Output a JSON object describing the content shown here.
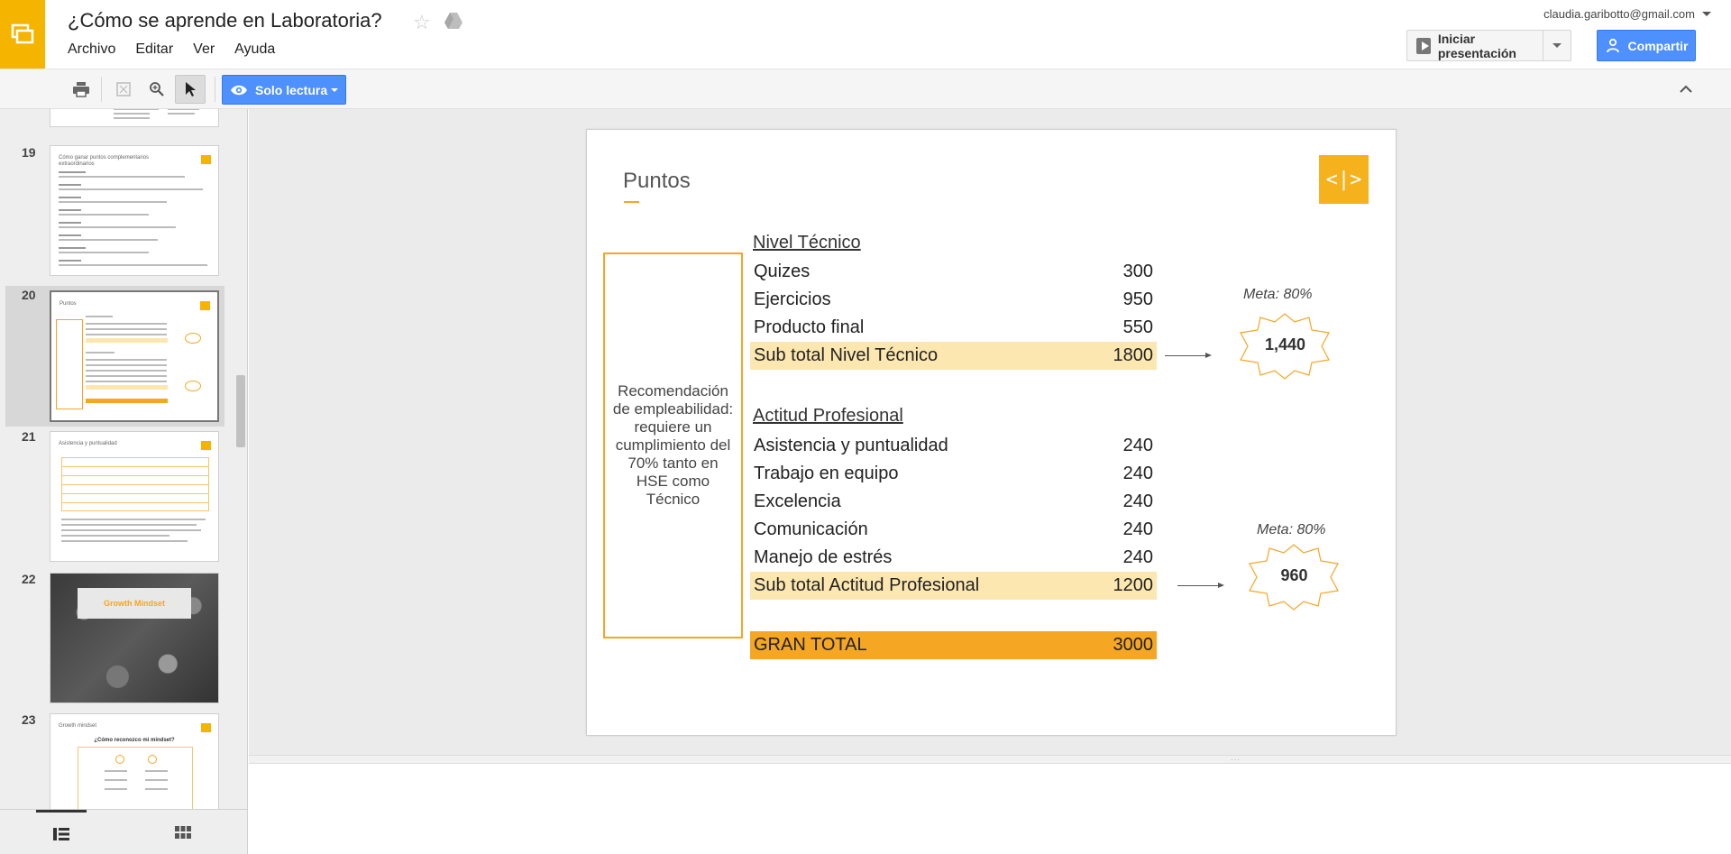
{
  "app": {
    "title": "¿Cómo se aprende en Laboratoria?",
    "account": "claudia.garibotto@gmail.com",
    "menu": [
      "Archivo",
      "Editar",
      "Ver",
      "Ayuda"
    ],
    "present_label": "Iniciar presentación",
    "share_label": "Compartir",
    "readonly_label": "Solo lectura"
  },
  "colors": {
    "brand": "#f4b400",
    "accent_orange": "#f5a623",
    "subtotal_fill": "#fde7b0",
    "primary_button": "#4d90fe"
  },
  "sidebar": {
    "slides": [
      {
        "number": "19",
        "title": "Cómo ganar puntos complementarios extraordinarios"
      },
      {
        "number": "20",
        "title": "Puntos",
        "selected": true
      },
      {
        "number": "21",
        "title": "Asistencia y puntualidad"
      },
      {
        "number": "22",
        "title": "Growth Mindset"
      },
      {
        "number": "23",
        "title": "Growth mindset",
        "subtitle": "¿Cómo reconozco mi mindset?"
      }
    ]
  },
  "slide": {
    "title": "Puntos",
    "logo_text": "<|>",
    "side_box_text": "Recomendación de empleabilidad: requiere un cumplimiento del 70% tanto en HSE como Técnico",
    "tecnico": {
      "heading": "Nivel Técnico",
      "rows": [
        {
          "label": "Quizes",
          "value": "300"
        },
        {
          "label": "Ejercicios",
          "value": "950"
        },
        {
          "label": "Producto final",
          "value": "550"
        }
      ],
      "subtotal": {
        "label": "Sub total Nivel Técnico",
        "value": "1800"
      },
      "meta_label": "Meta: 80%",
      "meta_value": "1,440"
    },
    "actitud": {
      "heading": "Actitud Profesional",
      "rows": [
        {
          "label": "Asistencia y puntualidad",
          "value": "240"
        },
        {
          "label": "Trabajo en equipo",
          "value": "240"
        },
        {
          "label": "Excelencia",
          "value": "240"
        },
        {
          "label": "Comunicación",
          "value": "240"
        },
        {
          "label": "Manejo de estrés",
          "value": "240"
        }
      ],
      "subtotal": {
        "label": "Sub total Actitud Profesional",
        "value": "1200"
      },
      "meta_label": "Meta: 80%",
      "meta_value": "960"
    },
    "grand_total": {
      "label": "GRAN TOTAL",
      "value": "3000"
    }
  }
}
